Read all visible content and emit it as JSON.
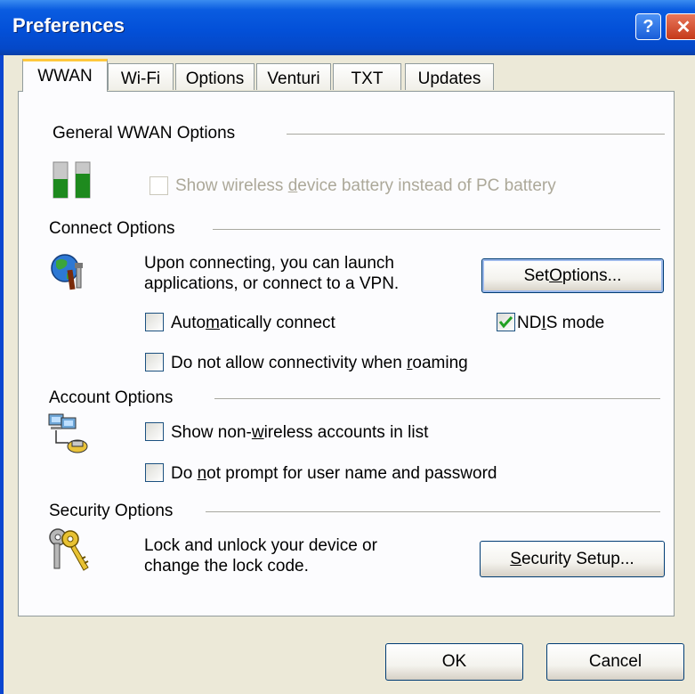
{
  "window": {
    "title": "Preferences",
    "help_glyph": "?",
    "close_glyph": "✕"
  },
  "tabs": [
    {
      "label": "WWAN",
      "active": true
    },
    {
      "label": "Wi-Fi"
    },
    {
      "label": "Options"
    },
    {
      "label": "Venturi"
    },
    {
      "label": "TXT"
    },
    {
      "label": "Updates"
    }
  ],
  "general": {
    "heading": "General WWAN Options",
    "battery_checkbox": {
      "pre": "Show wireless ",
      "accel": "d",
      "post": "evice battery instead of PC battery",
      "checked": false,
      "enabled": false
    }
  },
  "connect": {
    "heading": "Connect Options",
    "description_line1": "Upon connecting, you can launch",
    "description_line2": "applications, or connect to a VPN.",
    "set_options": {
      "pre": "Set ",
      "accel": "O",
      "post": "ptions..."
    },
    "auto_connect": {
      "pre": "Auto",
      "accel": "m",
      "post": "atically connect",
      "checked": false
    },
    "ndis_mode": {
      "pre": "ND",
      "accel": "I",
      "post": "S mode",
      "checked": true
    },
    "roaming": {
      "pre": "Do not allow connectivity when ",
      "accel": "r",
      "post": "oaming",
      "checked": false
    }
  },
  "account": {
    "heading": "Account Options",
    "non_wireless": {
      "pre": "Show non-",
      "accel": "w",
      "post": "ireless accounts in list",
      "checked": false
    },
    "no_prompt": {
      "pre": "Do ",
      "accel": "n",
      "post": "ot prompt for user name and password",
      "checked": false
    }
  },
  "security": {
    "heading": "Security Options",
    "description_line1": "Lock and unlock your device or",
    "description_line2": "change the lock code.",
    "setup_button": {
      "pre": "",
      "accel": "S",
      "post": "ecurity Setup..."
    }
  },
  "footer": {
    "ok_label": "OK",
    "cancel_label": "Cancel"
  },
  "colors": {
    "title_bar": "#0350D8",
    "dialog_bg": "#ECE9D8",
    "tab_highlight": "#FFC83C",
    "check_green": "#21A121"
  }
}
